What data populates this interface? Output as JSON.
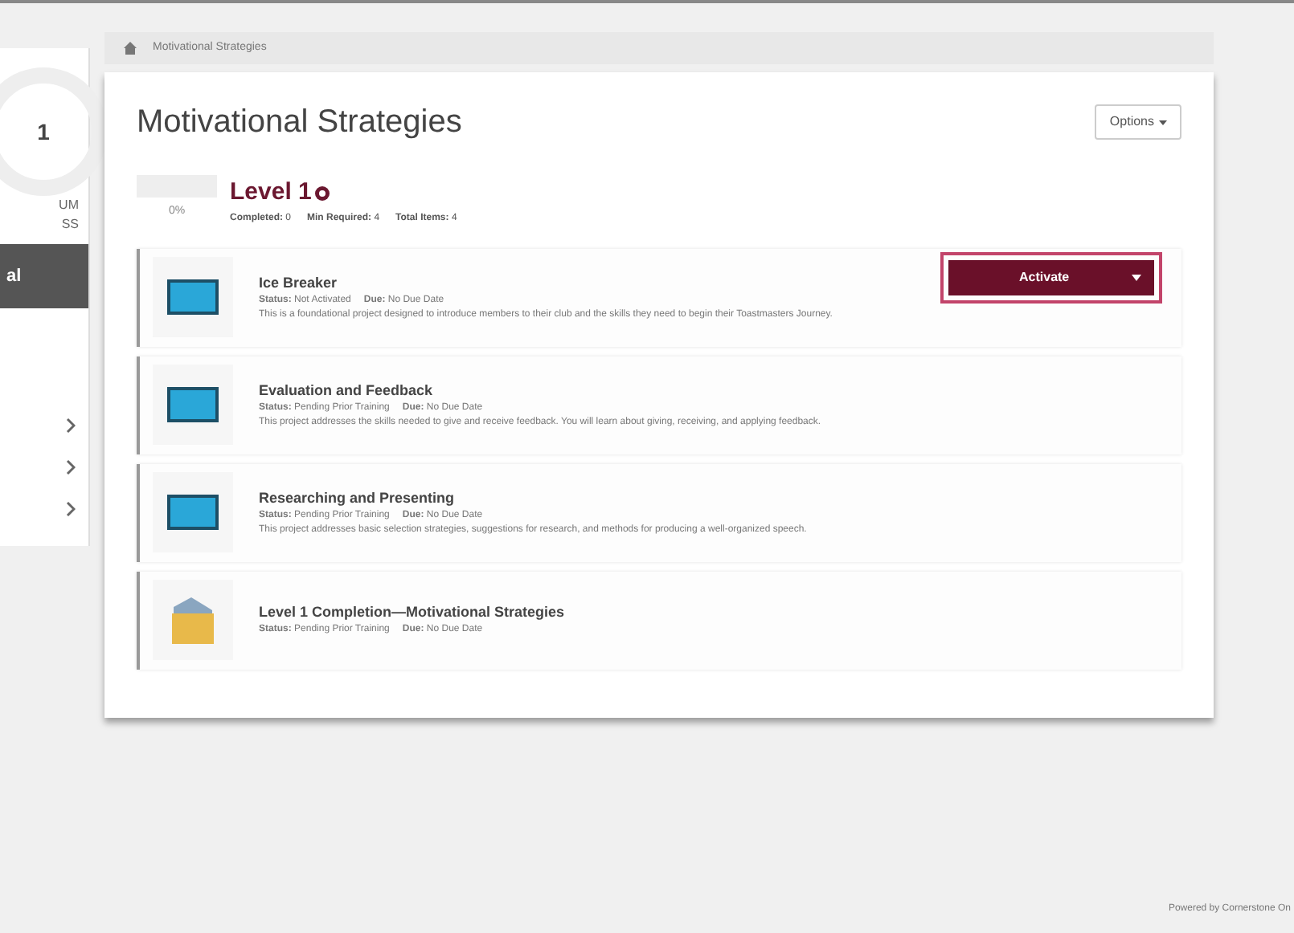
{
  "sidebar": {
    "circle_text": "1",
    "texts": [
      "UM",
      "SS"
    ],
    "active_item": "al"
  },
  "breadcrumb": {
    "current": "Motivational Strategies"
  },
  "page": {
    "title": "Motivational Strategies",
    "options": "Options"
  },
  "level": {
    "title": "Level 1",
    "level": 0,
    "percent": "0%",
    "completed_label": "Completed:",
    "completed": "0",
    "min_label": "Min Required:",
    "min": "4",
    "total_label": "Total Items:",
    "total": "4"
  },
  "items": [
    {
      "kind": "project",
      "title": "Ice Breaker",
      "status_label": "Status:",
      "status": "Not Activated",
      "due_label": "Due:",
      "due": "No Due Date",
      "description": "This is a foundational project designed to introduce members to their club and the skills they need to begin their Toastmasters Journey.",
      "action": "Activate"
    },
    {
      "kind": "project",
      "title": "Evaluation and Feedback",
      "status_label": "Status:",
      "status": "Pending Prior Training",
      "due_label": "Due:",
      "due": "No Due Date",
      "description": "This project addresses the skills needed to give and receive feedback. You will learn about giving, receiving, and applying feedback."
    },
    {
      "kind": "project",
      "title": "Researching and Presenting",
      "status_label": "Status:",
      "status": "Pending Prior Training",
      "due_label": "Due:",
      "due": "No Due Date",
      "description": "This project addresses basic selection strategies, suggestions for research, and methods for producing a well-organized speech."
    },
    {
      "kind": "completion",
      "title": "Level 1 Completion—Motivational Strategies",
      "status_label": "Status:",
      "status": "Pending Prior Training",
      "due_label": "Due:",
      "due": "No Due Date"
    }
  ],
  "footer": "Powered by Cornerstone On"
}
